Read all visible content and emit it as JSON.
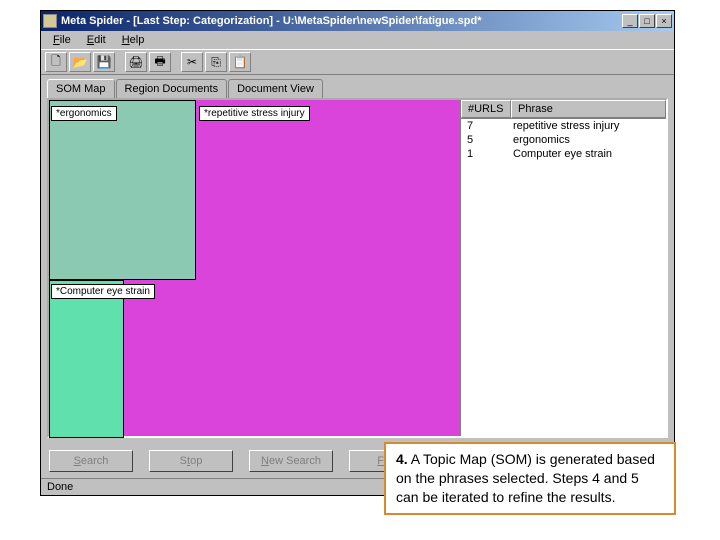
{
  "window": {
    "title": "Meta Spider - [Last Step: Categorization] - U:\\MetaSpider\\newSpider\\fatigue.spd*"
  },
  "menus": {
    "file": "File",
    "edit": "Edit",
    "help": "Help"
  },
  "tabs": {
    "som": "SOM Map",
    "region": "Region Documents",
    "docview": "Document View"
  },
  "map": {
    "ergonomics": "*ergonomics",
    "repetitive": "*repetitive stress injury",
    "eyestrain": "*Computer eye strain"
  },
  "phrase_table": {
    "col_urls": "#URLS",
    "col_phrase": "Phrase",
    "rows": [
      {
        "count": "7",
        "phrase": "repetitive stress injury"
      },
      {
        "count": "5",
        "phrase": "ergonomics"
      },
      {
        "count": "1",
        "phrase": "Computer eye strain"
      }
    ]
  },
  "buttons": {
    "search": "Search",
    "stop": "Stop",
    "newsearch": "New Search",
    "fetch": "Fetch"
  },
  "status": "Done",
  "callout": {
    "num": "4.",
    "text": " A Topic Map (SOM) is generated based on the phrases selected. Steps 4 and 5 can be iterated to refine the results."
  }
}
